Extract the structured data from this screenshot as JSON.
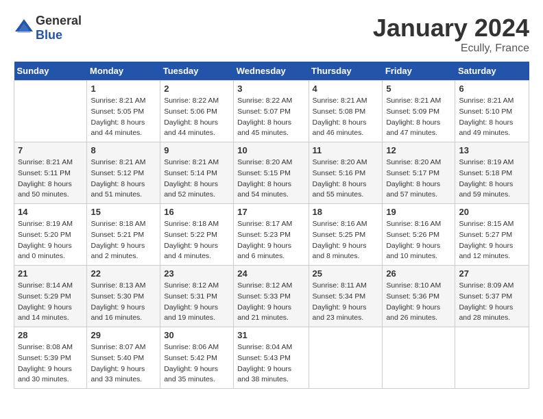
{
  "header": {
    "logo_general": "General",
    "logo_blue": "Blue",
    "month": "January 2024",
    "location": "Ecully, France"
  },
  "calendar": {
    "days_of_week": [
      "Sunday",
      "Monday",
      "Tuesday",
      "Wednesday",
      "Thursday",
      "Friday",
      "Saturday"
    ],
    "weeks": [
      [
        {
          "day": "",
          "sunrise": "",
          "sunset": "",
          "daylight": ""
        },
        {
          "day": "1",
          "sunrise": "Sunrise: 8:21 AM",
          "sunset": "Sunset: 5:05 PM",
          "daylight": "Daylight: 8 hours and 44 minutes."
        },
        {
          "day": "2",
          "sunrise": "Sunrise: 8:22 AM",
          "sunset": "Sunset: 5:06 PM",
          "daylight": "Daylight: 8 hours and 44 minutes."
        },
        {
          "day": "3",
          "sunrise": "Sunrise: 8:22 AM",
          "sunset": "Sunset: 5:07 PM",
          "daylight": "Daylight: 8 hours and 45 minutes."
        },
        {
          "day": "4",
          "sunrise": "Sunrise: 8:21 AM",
          "sunset": "Sunset: 5:08 PM",
          "daylight": "Daylight: 8 hours and 46 minutes."
        },
        {
          "day": "5",
          "sunrise": "Sunrise: 8:21 AM",
          "sunset": "Sunset: 5:09 PM",
          "daylight": "Daylight: 8 hours and 47 minutes."
        },
        {
          "day": "6",
          "sunrise": "Sunrise: 8:21 AM",
          "sunset": "Sunset: 5:10 PM",
          "daylight": "Daylight: 8 hours and 49 minutes."
        }
      ],
      [
        {
          "day": "7",
          "sunrise": "Sunrise: 8:21 AM",
          "sunset": "Sunset: 5:11 PM",
          "daylight": "Daylight: 8 hours and 50 minutes."
        },
        {
          "day": "8",
          "sunrise": "Sunrise: 8:21 AM",
          "sunset": "Sunset: 5:12 PM",
          "daylight": "Daylight: 8 hours and 51 minutes."
        },
        {
          "day": "9",
          "sunrise": "Sunrise: 8:21 AM",
          "sunset": "Sunset: 5:14 PM",
          "daylight": "Daylight: 8 hours and 52 minutes."
        },
        {
          "day": "10",
          "sunrise": "Sunrise: 8:20 AM",
          "sunset": "Sunset: 5:15 PM",
          "daylight": "Daylight: 8 hours and 54 minutes."
        },
        {
          "day": "11",
          "sunrise": "Sunrise: 8:20 AM",
          "sunset": "Sunset: 5:16 PM",
          "daylight": "Daylight: 8 hours and 55 minutes."
        },
        {
          "day": "12",
          "sunrise": "Sunrise: 8:20 AM",
          "sunset": "Sunset: 5:17 PM",
          "daylight": "Daylight: 8 hours and 57 minutes."
        },
        {
          "day": "13",
          "sunrise": "Sunrise: 8:19 AM",
          "sunset": "Sunset: 5:18 PM",
          "daylight": "Daylight: 8 hours and 59 minutes."
        }
      ],
      [
        {
          "day": "14",
          "sunrise": "Sunrise: 8:19 AM",
          "sunset": "Sunset: 5:20 PM",
          "daylight": "Daylight: 9 hours and 0 minutes."
        },
        {
          "day": "15",
          "sunrise": "Sunrise: 8:18 AM",
          "sunset": "Sunset: 5:21 PM",
          "daylight": "Daylight: 9 hours and 2 minutes."
        },
        {
          "day": "16",
          "sunrise": "Sunrise: 8:18 AM",
          "sunset": "Sunset: 5:22 PM",
          "daylight": "Daylight: 9 hours and 4 minutes."
        },
        {
          "day": "17",
          "sunrise": "Sunrise: 8:17 AM",
          "sunset": "Sunset: 5:23 PM",
          "daylight": "Daylight: 9 hours and 6 minutes."
        },
        {
          "day": "18",
          "sunrise": "Sunrise: 8:16 AM",
          "sunset": "Sunset: 5:25 PM",
          "daylight": "Daylight: 9 hours and 8 minutes."
        },
        {
          "day": "19",
          "sunrise": "Sunrise: 8:16 AM",
          "sunset": "Sunset: 5:26 PM",
          "daylight": "Daylight: 9 hours and 10 minutes."
        },
        {
          "day": "20",
          "sunrise": "Sunrise: 8:15 AM",
          "sunset": "Sunset: 5:27 PM",
          "daylight": "Daylight: 9 hours and 12 minutes."
        }
      ],
      [
        {
          "day": "21",
          "sunrise": "Sunrise: 8:14 AM",
          "sunset": "Sunset: 5:29 PM",
          "daylight": "Daylight: 9 hours and 14 minutes."
        },
        {
          "day": "22",
          "sunrise": "Sunrise: 8:13 AM",
          "sunset": "Sunset: 5:30 PM",
          "daylight": "Daylight: 9 hours and 16 minutes."
        },
        {
          "day": "23",
          "sunrise": "Sunrise: 8:12 AM",
          "sunset": "Sunset: 5:31 PM",
          "daylight": "Daylight: 9 hours and 19 minutes."
        },
        {
          "day": "24",
          "sunrise": "Sunrise: 8:12 AM",
          "sunset": "Sunset: 5:33 PM",
          "daylight": "Daylight: 9 hours and 21 minutes."
        },
        {
          "day": "25",
          "sunrise": "Sunrise: 8:11 AM",
          "sunset": "Sunset: 5:34 PM",
          "daylight": "Daylight: 9 hours and 23 minutes."
        },
        {
          "day": "26",
          "sunrise": "Sunrise: 8:10 AM",
          "sunset": "Sunset: 5:36 PM",
          "daylight": "Daylight: 9 hours and 26 minutes."
        },
        {
          "day": "27",
          "sunrise": "Sunrise: 8:09 AM",
          "sunset": "Sunset: 5:37 PM",
          "daylight": "Daylight: 9 hours and 28 minutes."
        }
      ],
      [
        {
          "day": "28",
          "sunrise": "Sunrise: 8:08 AM",
          "sunset": "Sunset: 5:39 PM",
          "daylight": "Daylight: 9 hours and 30 minutes."
        },
        {
          "day": "29",
          "sunrise": "Sunrise: 8:07 AM",
          "sunset": "Sunset: 5:40 PM",
          "daylight": "Daylight: 9 hours and 33 minutes."
        },
        {
          "day": "30",
          "sunrise": "Sunrise: 8:06 AM",
          "sunset": "Sunset: 5:42 PM",
          "daylight": "Daylight: 9 hours and 35 minutes."
        },
        {
          "day": "31",
          "sunrise": "Sunrise: 8:04 AM",
          "sunset": "Sunset: 5:43 PM",
          "daylight": "Daylight: 9 hours and 38 minutes."
        },
        {
          "day": "",
          "sunrise": "",
          "sunset": "",
          "daylight": ""
        },
        {
          "day": "",
          "sunrise": "",
          "sunset": "",
          "daylight": ""
        },
        {
          "day": "",
          "sunrise": "",
          "sunset": "",
          "daylight": ""
        }
      ]
    ]
  }
}
